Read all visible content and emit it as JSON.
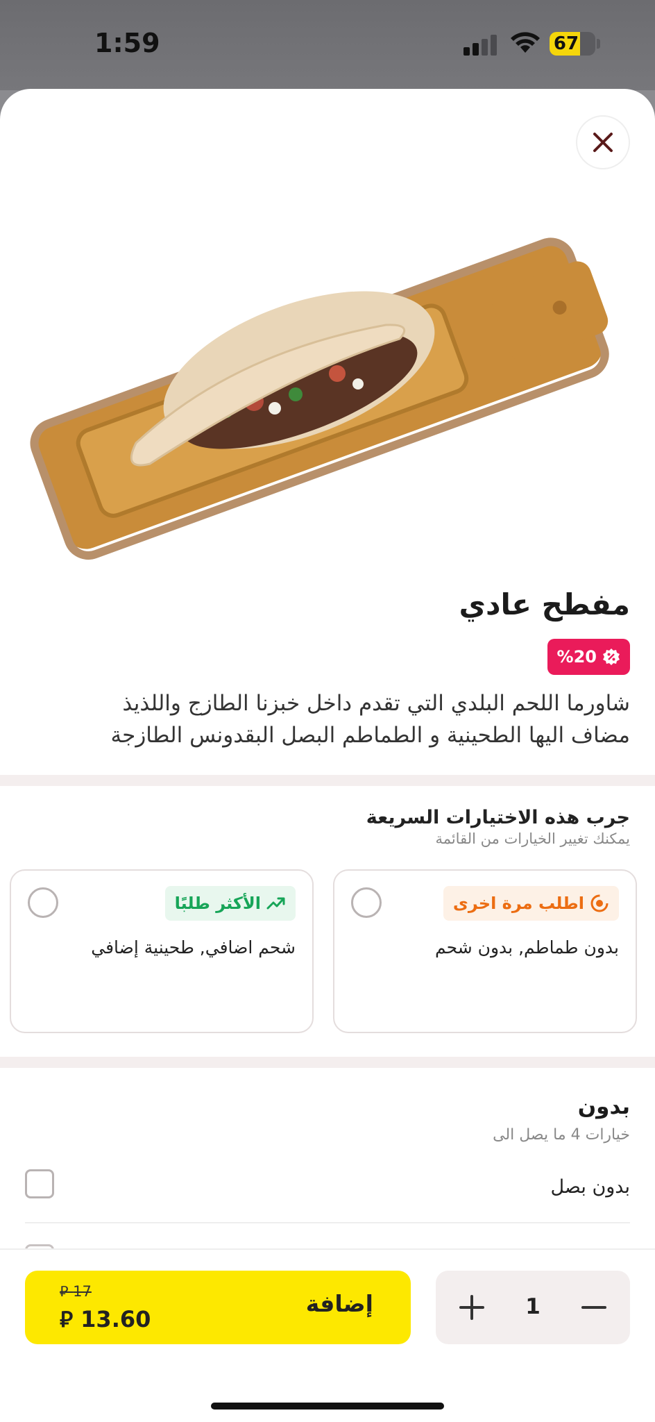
{
  "status_bar": {
    "time": "1:59",
    "battery_level": "67",
    "battery_fraction": 0.67
  },
  "product": {
    "title": "مفطح عادي",
    "discount": "%20",
    "description": "شاورما اللحم البلدي التي تقدم داخل خبزنا الطازج واللذيذ مضاف اليها الطحينية و الطماطم البصل البقدونس الطازجة",
    "image_icon": "shawarma-on-board-image"
  },
  "quick_choices": {
    "title": "جرب هذه الاختيارات السريعة",
    "subtitle": "يمكنك تغيير الخيارات من القائمة",
    "cards": [
      {
        "tag": "اطلب مرة اخرى",
        "tag_icon": "reorder-icon",
        "text": "بدون طماطم, بدون شحم",
        "tag_color": "#ec6d12"
      },
      {
        "tag": "الأكثر طلبًا",
        "tag_icon": "trending-up-icon",
        "text": "شحم اضافي, طحينية إضافي",
        "tag_color": "#17a558"
      }
    ]
  },
  "options_section": {
    "title": "بدون",
    "subtitle": "خيارات 4 ما يصل الى",
    "items": [
      {
        "label": "بدون بصل"
      }
    ]
  },
  "bottom_bar": {
    "add_label": "إضافة",
    "old_price": "17 ⃁",
    "new_price": "13.60 ⃁",
    "quantity": "1"
  },
  "colors": {
    "accent_yellow": "#fde800",
    "discount_pink": "#ea1b5a",
    "battery_yellow": "#f5d60a"
  }
}
